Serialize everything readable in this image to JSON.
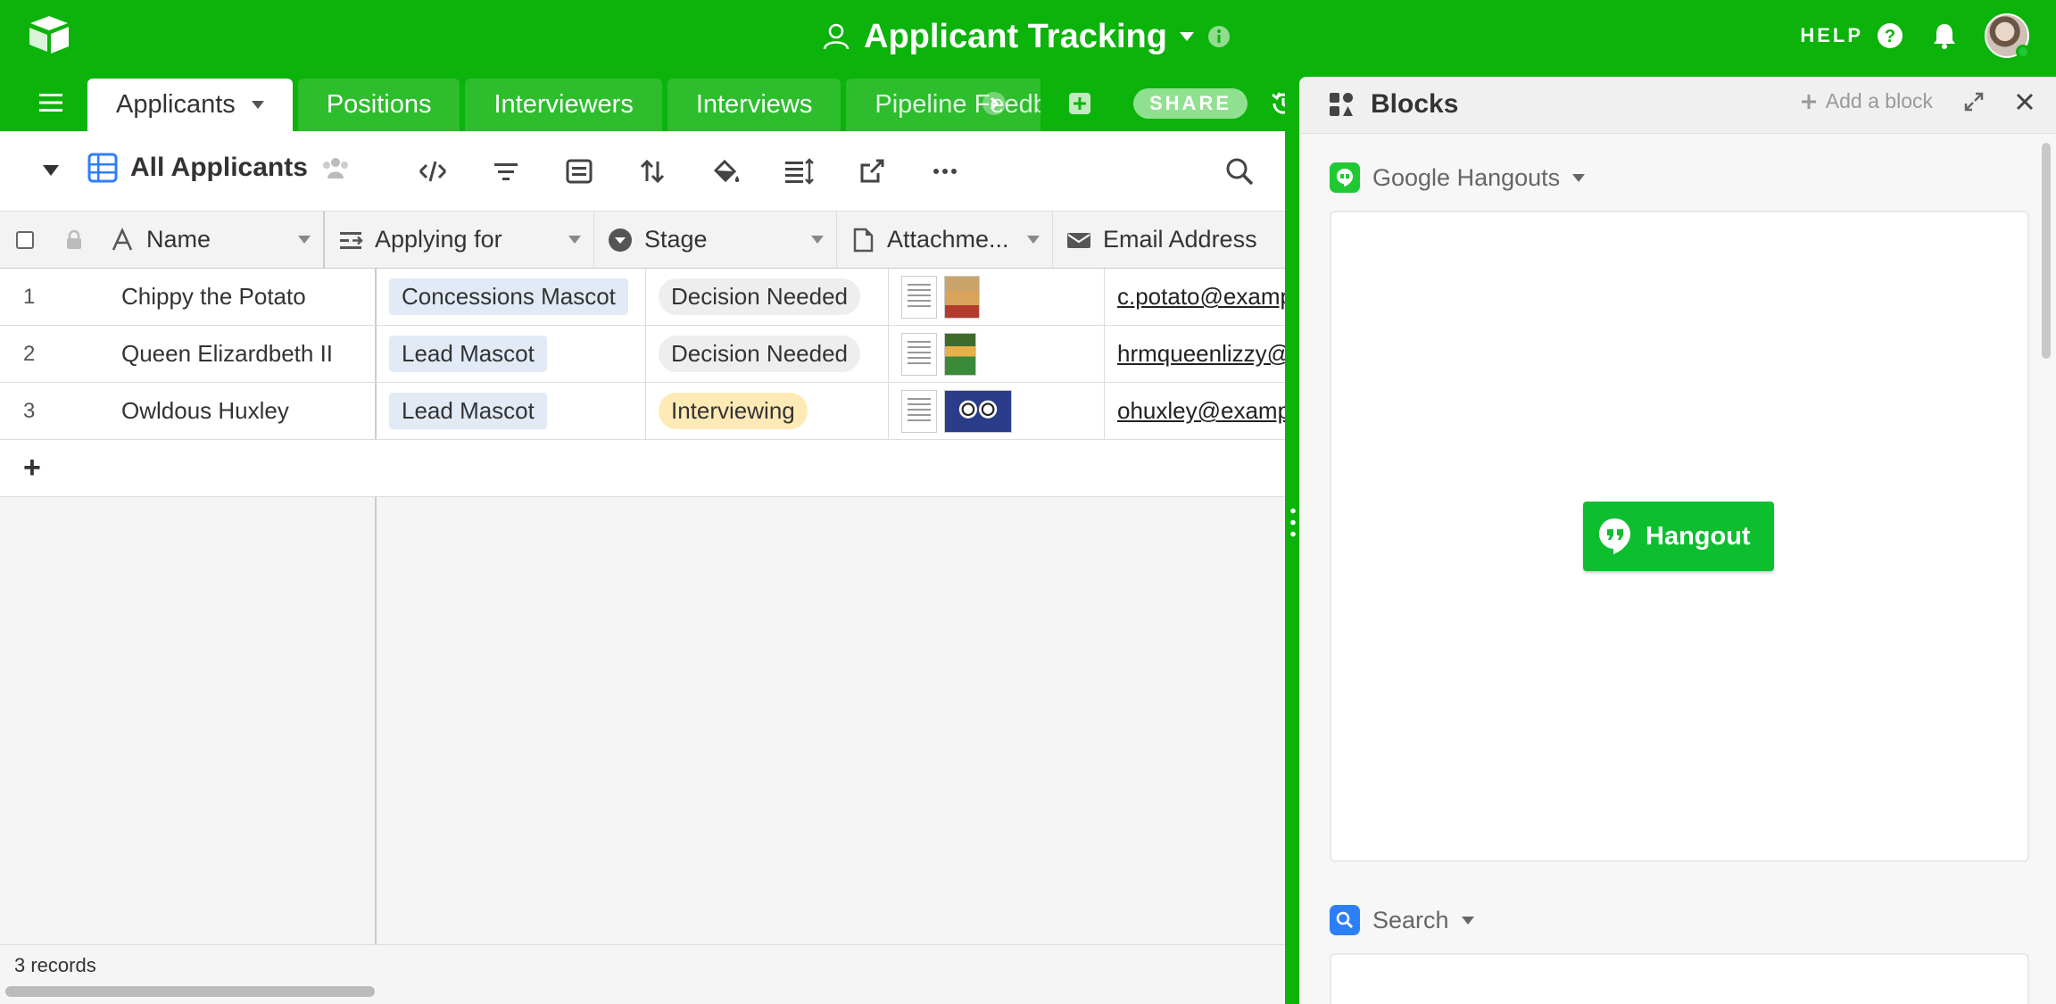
{
  "app": {
    "base_title": "Applicant Tracking",
    "help_label": "HELP"
  },
  "tabs": [
    {
      "label": "Applicants",
      "active": true
    },
    {
      "label": "Positions"
    },
    {
      "label": "Interviewers"
    },
    {
      "label": "Interviews"
    },
    {
      "label": "Pipeline Feedback"
    }
  ],
  "toolbar": {
    "share_label": "SHARE"
  },
  "view": {
    "name": "All Applicants"
  },
  "table": {
    "columns": [
      {
        "label": "Name",
        "icon": "text-field-icon"
      },
      {
        "label": "Applying for",
        "icon": "linked-record-icon"
      },
      {
        "label": "Stage",
        "icon": "single-select-icon"
      },
      {
        "label": "Attachme...",
        "icon": "attachment-icon"
      },
      {
        "label": "Email Address",
        "icon": "email-icon"
      }
    ],
    "rows": [
      {
        "num": "1",
        "name": "Chippy the Potato",
        "applying_for": "Concessions Mascot",
        "stage": "Decision Needed",
        "email": "c.potato@example.com"
      },
      {
        "num": "2",
        "name": "Queen Elizardbeth II",
        "applying_for": "Lead Mascot",
        "stage": "Decision Needed",
        "email": "hrmqueenlizzy@example.com"
      },
      {
        "num": "3",
        "name": "Owldous Huxley",
        "applying_for": "Lead Mascot",
        "stage": "Interviewing",
        "email": "ohuxley@example.com"
      }
    ],
    "add_row_symbol": "+",
    "records_count": "3 records"
  },
  "colors": {
    "brand_green": "#0bb30b",
    "stage_decision": "#eeeeee",
    "stage_interviewing": "#ffeab6",
    "hangout_green": "#0dbf2f",
    "search_blue": "#2d7ff9"
  },
  "blocks": {
    "title": "Blocks",
    "add_block_label": "Add a block",
    "items": [
      {
        "name": "Google Hangouts",
        "button_label": "Hangout"
      },
      {
        "name": "Search"
      }
    ]
  }
}
